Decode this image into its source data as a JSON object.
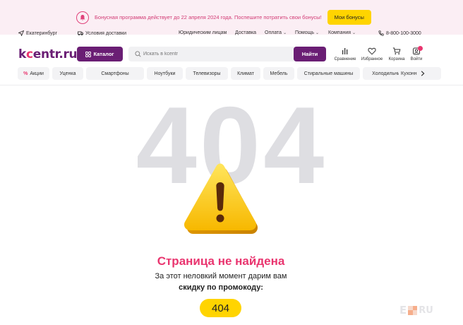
{
  "promo": {
    "text": "Бонусная программа действует до 22 апреля 2024 года. Поспешите потратить свои бонусы!",
    "button": "Мои бонусы",
    "icon": "bell-icon"
  },
  "util": {
    "city": "Екатеринбург",
    "delivery": "Условия доставки",
    "links": [
      "Юридическим лицам",
      "Доставка",
      "Оплата",
      "Помощь",
      "Компания"
    ],
    "phone": "8-800-100-3000"
  },
  "header": {
    "logo_a": "k",
    "logo_o": "c",
    "logo_b": "entr.ru",
    "catalog": "Каталог",
    "search_placeholder": "Искать в kcentr",
    "search_button": "Найти",
    "icons": [
      {
        "label": "Сравнение",
        "icon": "compare-icon"
      },
      {
        "label": "Избранное",
        "icon": "heart-icon"
      },
      {
        "label": "Корзина",
        "icon": "cart-icon"
      },
      {
        "label": "Войти",
        "icon": "user-icon"
      }
    ]
  },
  "categories": {
    "sale_mark": "%",
    "items": [
      "Акции",
      "Уценка",
      "Смартфоны",
      "Ноутбуки",
      "Телевизоры",
      "Климат",
      "Мебель",
      "Стиральные машины",
      "Холодильники",
      "Кухонн"
    ]
  },
  "error": {
    "code_big": "404",
    "title": "Страница не найдена",
    "line1": "За этот неловкий момент дарим вам",
    "line2": "скидку по промокоду:",
    "promo_code": "404"
  },
  "watermark": {
    "left": "E",
    "right": "RU"
  },
  "colors": {
    "brand": "#6a1e74",
    "accent": "#e9356f",
    "yellow": "#ffd400"
  }
}
